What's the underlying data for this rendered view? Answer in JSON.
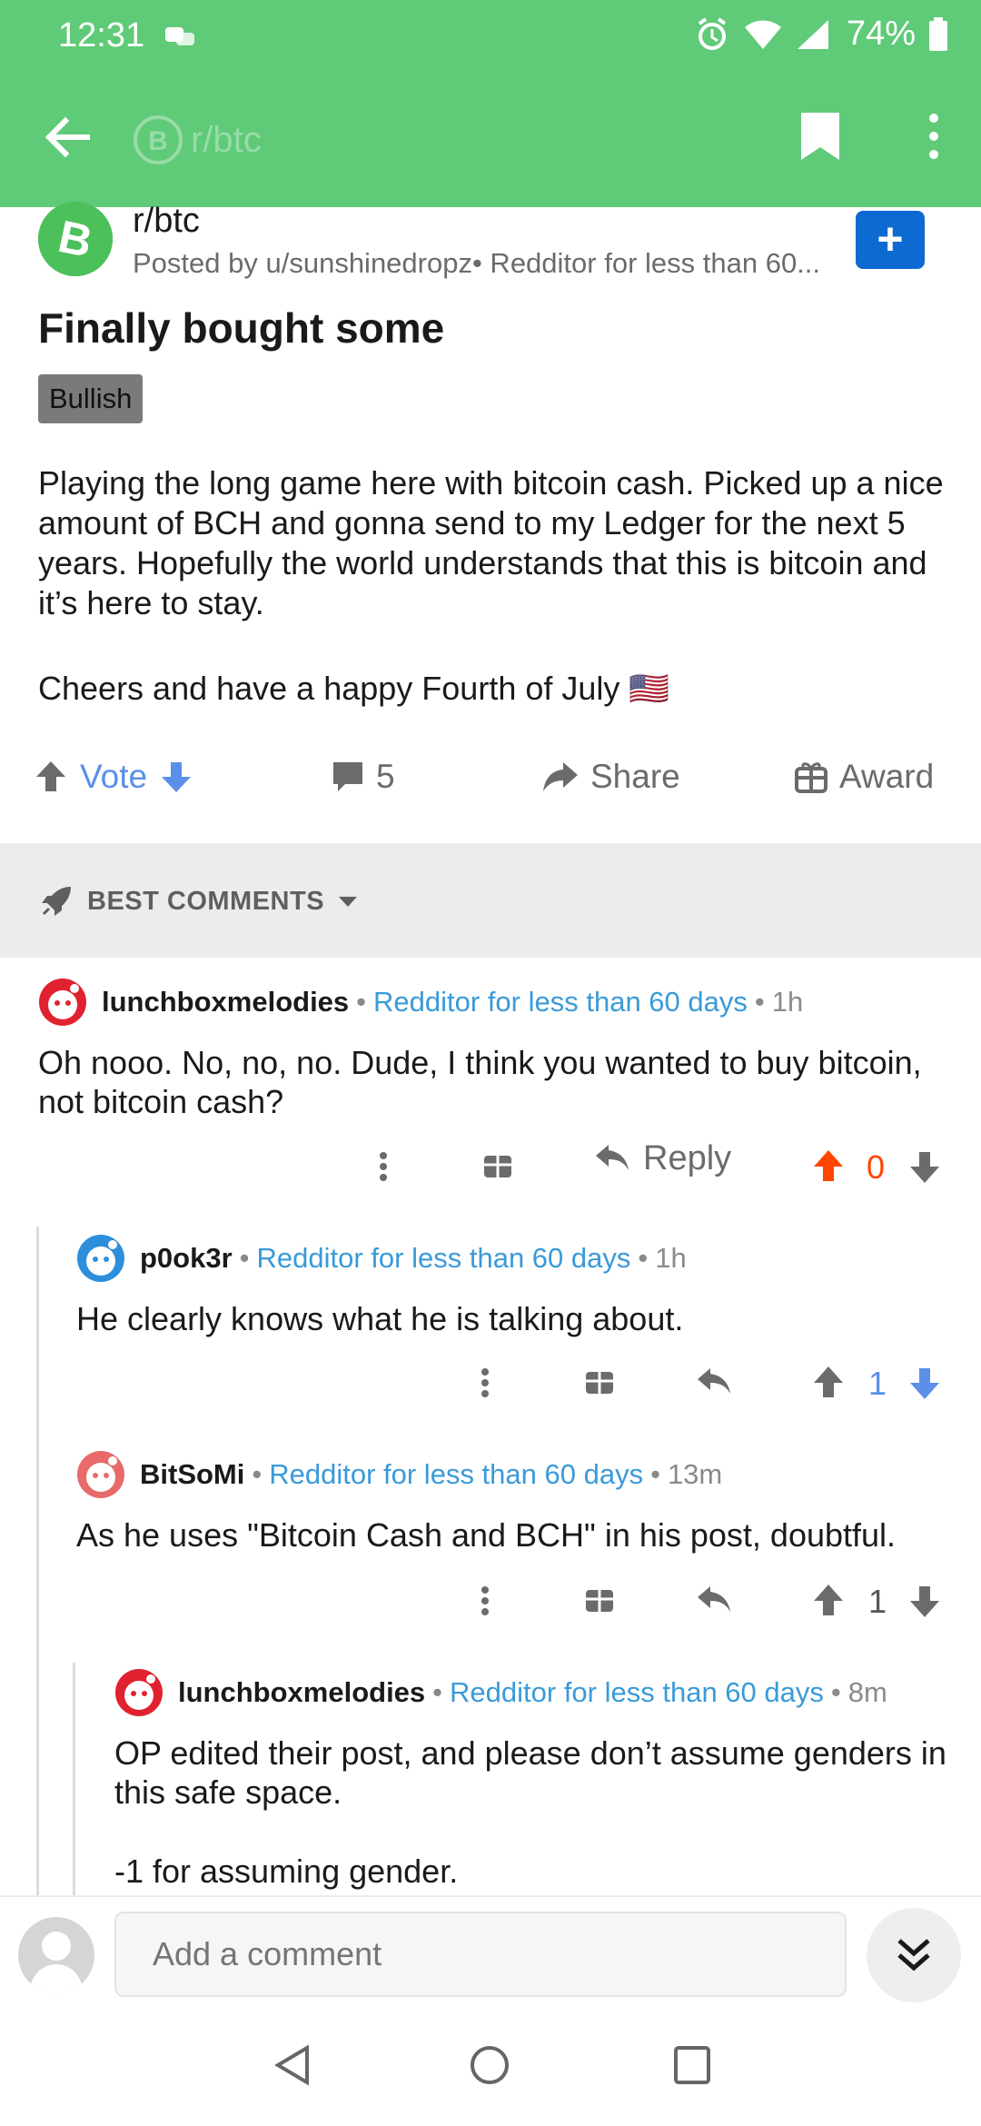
{
  "status": {
    "time": "12:31",
    "battery": "74%"
  },
  "appbar": {
    "subreddit": "r/btc",
    "back_icon": "arrow-left-icon",
    "bookmark_icon": "bookmark-icon",
    "more_icon": "more-vert-icon"
  },
  "post": {
    "subreddit": "r/btc",
    "meta": "Posted by u/sunshinedropz• Redditor for less than 60...",
    "title": "Finally bought some",
    "flair": "Bullish",
    "body": [
      "Playing the long game here with bitcoin cash. Picked up a nice amount of BCH and gonna send to my Ledger for the next 5 years. Hopefully the world understands that this is bitcoin and it’s here to stay.",
      "Cheers and have a happy Fourth of July 🇺🇸"
    ],
    "join_label": "+"
  },
  "actions": {
    "vote": "Vote",
    "comments": "5",
    "share": "Share",
    "award": "Award"
  },
  "sort": {
    "label": "BEST COMMENTS"
  },
  "comments": [
    {
      "user": "lunchboxmelodies",
      "tag": "Redditor for less than 60 days",
      "age": "1h",
      "body": "Oh nooo. No, no, no. Dude, I think you wanted to buy bitcoin, not bitcoin cash?",
      "reply_label": "Reply",
      "score": "0",
      "vote_state": "up"
    },
    {
      "user": "p0ok3r",
      "tag": "Redditor for less than 60 days",
      "age": "1h",
      "body": "He clearly knows what he is talking about.",
      "score": "1",
      "vote_state": "down"
    },
    {
      "user": "BitSoMi",
      "tag": "Redditor for less than 60 days",
      "age": "13m",
      "body": "As he uses \"Bitcoin Cash and BCH\" in his post, doubtful.",
      "score": "1",
      "vote_state": "none"
    },
    {
      "user": "lunchboxmelodies",
      "tag": "Redditor for less than 60 days",
      "age": "8m",
      "body": "OP edited their post, and please don’t assume genders in this safe space.",
      "body2": "-1 for assuming gender."
    }
  ],
  "composer": {
    "placeholder": "Add a comment"
  },
  "colors": {
    "appbar": "#5fca78",
    "link": "#3a9ad9",
    "upvote": "#ff4500",
    "downvote": "#5b8fe8",
    "join": "#0d6ad1"
  }
}
